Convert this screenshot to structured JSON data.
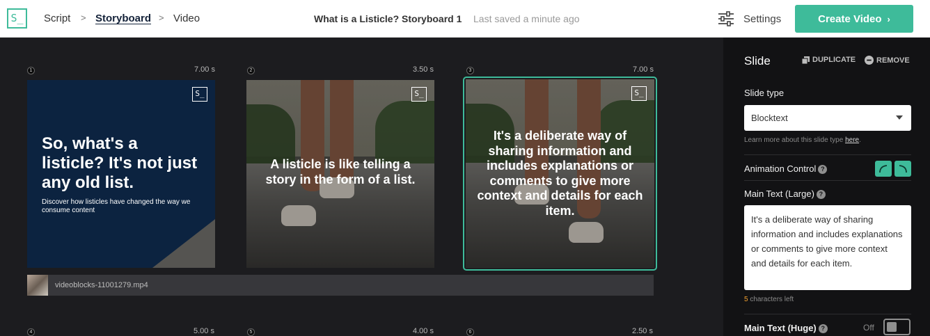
{
  "brand": {
    "logo_text": "S_",
    "accent": "#3ebb9a"
  },
  "nav": {
    "script": "Script",
    "storyboard": "Storyboard",
    "video": "Video",
    "chevron": ">"
  },
  "document": {
    "title": "What is a Listicle? Storyboard 1",
    "saved_status": "Last saved a minute ago"
  },
  "toolbar": {
    "settings_label": "Settings",
    "create_label": "Create Video",
    "create_arrow": "›"
  },
  "slides": [
    {
      "number": "1",
      "duration": "7.00 s",
      "headline": "So, what's a listicle? It's not just any old list.",
      "subtext": "Discover how listicles have changed the way we consume content",
      "brand_mark": "S_"
    },
    {
      "number": "2",
      "duration": "3.50 s",
      "text": "A listicle is like telling a story in the form of a list.",
      "brand_mark": "S_"
    },
    {
      "number": "3",
      "duration": "7.00 s",
      "text": "It's a deliberate way of sharing information and includes explanations or comments to give more context and details for each item.",
      "brand_mark": "S_",
      "selected": true
    }
  ],
  "next_row": [
    {
      "number": "4",
      "duration": "5.00 s"
    },
    {
      "number": "5",
      "duration": "4.00 s"
    },
    {
      "number": "6",
      "duration": "2.50 s"
    }
  ],
  "clip": {
    "filename": "videoblocks-11001279.mp4"
  },
  "panel": {
    "title": "Slide",
    "duplicate_label": "DUPLICATE",
    "remove_label": "REMOVE",
    "slide_type_label": "Slide type",
    "slide_type_value": "Blocktext",
    "learn_more_prefix": "Learn more about this slide type ",
    "learn_more_link": "here",
    "learn_more_suffix": ".",
    "animation_control_label": "Animation Control",
    "help_glyph": "?",
    "main_text_large_label": "Main Text (Large)",
    "main_text_large_value": "It's a deliberate way of sharing information and includes explanations or comments to give more context and details for each item.",
    "chars_left_count": "5",
    "chars_left_suffix": " characters left",
    "main_text_huge_label": "Main Text (Huge)",
    "main_text_huge_state": "Off"
  }
}
